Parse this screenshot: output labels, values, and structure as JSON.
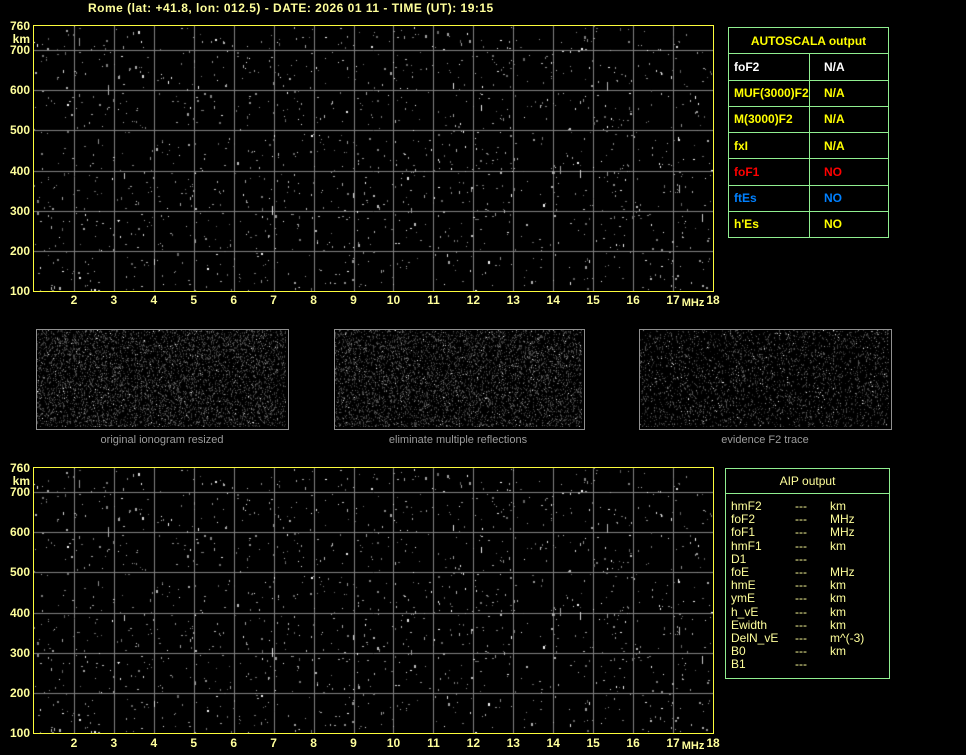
{
  "title": "Rome (lat: +41.8, lon: 012.5) - DATE: 2026 01 11 - TIME (UT): 19:15",
  "ionogram_axes": {
    "y_unit": "km",
    "x_unit": "MHz",
    "y_ticks": [
      760,
      700,
      600,
      500,
      400,
      300,
      200,
      100
    ],
    "x_ticks": [
      2,
      3,
      4,
      5,
      6,
      7,
      8,
      9,
      10,
      11,
      12,
      13,
      14,
      15,
      16,
      17,
      18
    ],
    "x_range": [
      1,
      18
    ],
    "y_range": [
      100,
      760
    ]
  },
  "autoscala": {
    "title": "AUTOSCALA output",
    "rows": [
      {
        "label": "foF2",
        "value": "N/A",
        "color": "#FFFFFF"
      },
      {
        "label": "MUF(3000)F2",
        "value": "N/A",
        "color": "#FFFF00"
      },
      {
        "label": "M(3000)F2",
        "value": "N/A",
        "color": "#FFFF00"
      },
      {
        "label": "fxI",
        "value": "N/A",
        "color": "#FFFF00"
      },
      {
        "label": "foF1",
        "value": "NO",
        "color": "#FF0000"
      },
      {
        "label": "ftEs",
        "value": "NO",
        "color": "#0080FF"
      },
      {
        "label": "h'Es",
        "value": "NO",
        "color": "#FFFF00"
      }
    ]
  },
  "panels": [
    {
      "caption": "original ionogram resized"
    },
    {
      "caption": "eliminate multiple reflections"
    },
    {
      "caption": "evidence F2 trace"
    }
  ],
  "aip": {
    "title": "AIP output",
    "rows": [
      {
        "param": "hmF2",
        "value": "---",
        "unit": "km"
      },
      {
        "param": "foF2",
        "value": "---",
        "unit": "MHz"
      },
      {
        "param": "foF1",
        "value": "---",
        "unit": "MHz"
      },
      {
        "param": "hmF1",
        "value": "---",
        "unit": "km"
      },
      {
        "param": "D1",
        "value": "---",
        "unit": ""
      },
      {
        "param": "foE",
        "value": "---",
        "unit": "MHz"
      },
      {
        "param": "hmE",
        "value": "---",
        "unit": "km"
      },
      {
        "param": "ymE",
        "value": "---",
        "unit": "km"
      },
      {
        "param": "h_vE",
        "value": "---",
        "unit": "km"
      },
      {
        "param": "Ewidth",
        "value": "---",
        "unit": "km"
      },
      {
        "param": "DelN_vE",
        "value": "---",
        "unit": "m^(-3)"
      },
      {
        "param": "B0",
        "value": "---",
        "unit": "km"
      },
      {
        "param": "B1",
        "value": "---",
        "unit": ""
      }
    ]
  },
  "colors": {
    "text_yellow": "#FFFF9B",
    "table_yellow": "#FFFF00",
    "status_no_f1": "#FF0000",
    "status_no_es": "#0080FF",
    "plot_border": "#FCFC3C",
    "table_border": "#90EE90",
    "grid": "#828282",
    "caption_gray": "#9C9C9C"
  }
}
